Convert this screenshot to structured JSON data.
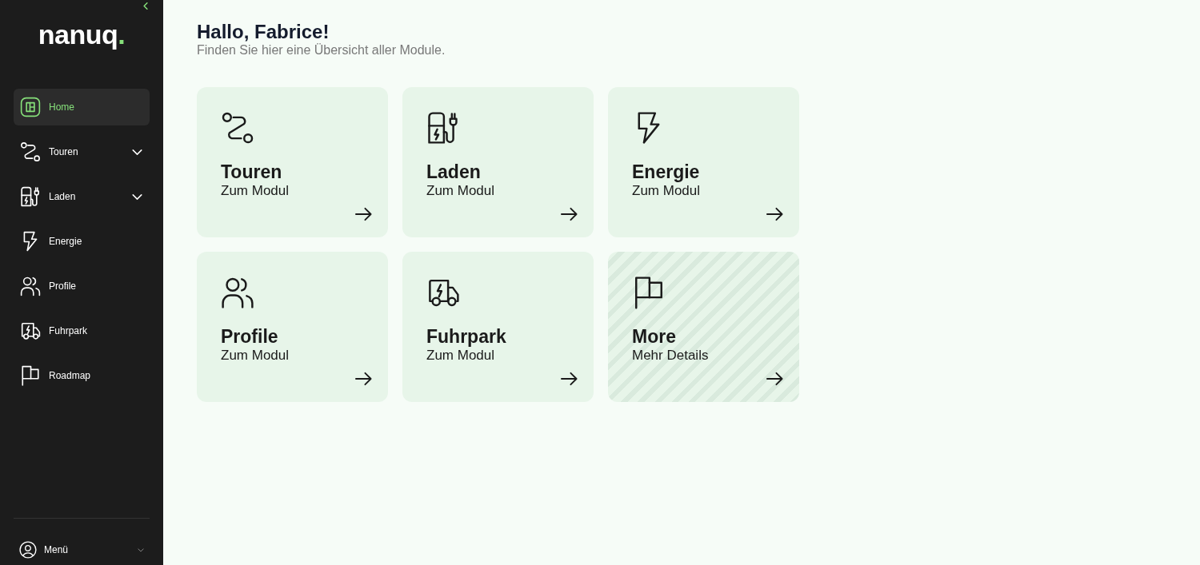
{
  "sidebar": {
    "logo": {
      "text": "nanuq",
      "accent": "."
    },
    "nav": {
      "items": [
        {
          "label": "Home",
          "kind": "link",
          "selected": true
        },
        {
          "label": "Touren",
          "kind": "group",
          "selected": false
        },
        {
          "label": "Laden",
          "kind": "group",
          "selected": false
        },
        {
          "label": "Energie",
          "kind": "link",
          "selected": false
        },
        {
          "label": "Profile",
          "kind": "link",
          "selected": false
        },
        {
          "label": "Fuhrpark",
          "kind": "link",
          "selected": false
        },
        {
          "label": "Roadmap",
          "kind": "link",
          "selected": false
        }
      ]
    },
    "account_menu": {
      "label": "Menü"
    }
  },
  "main": {
    "greeting": "Hallo, Fabrice!",
    "subtitle": "Finden Sie hier eine Übersicht aller Module.",
    "cards": [
      {
        "title": "Touren",
        "subtitle": "Zum Modul",
        "kind": "module"
      },
      {
        "title": "Laden",
        "subtitle": "Zum Modul",
        "kind": "module"
      },
      {
        "title": "Energie",
        "subtitle": "Zum Modul",
        "kind": "module"
      },
      {
        "title": "Profile",
        "subtitle": "Zum Modul",
        "kind": "module"
      },
      {
        "title": "Fuhrpark",
        "subtitle": "Zum Modul",
        "kind": "module"
      },
      {
        "title": "More",
        "subtitle": "Mehr Details",
        "kind": "more"
      }
    ]
  }
}
